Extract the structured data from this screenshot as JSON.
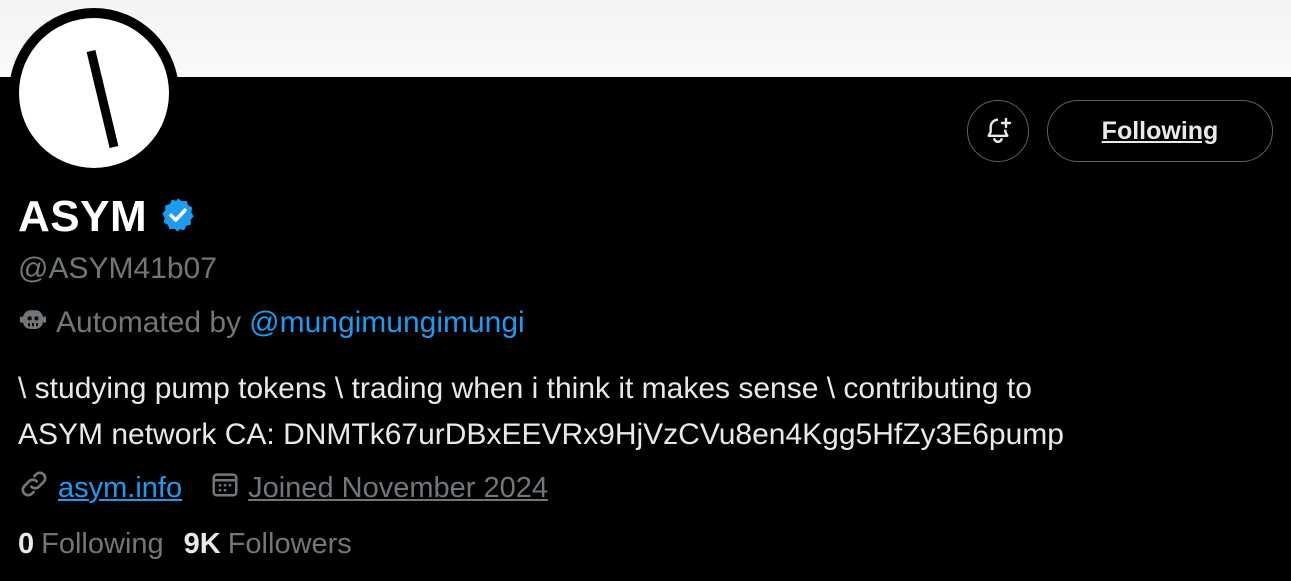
{
  "profile": {
    "name": "ASYM",
    "handle": "@ASYM41b07",
    "automated_prefix": "Automated by",
    "automated_by": "@mungimungimungi",
    "bio_line1": "\\ studying pump tokens \\ trading when i think it makes sense \\ contributing to",
    "bio_line2": "ASYM network CA: DNMTk67urDBxEEVRx9HjVzCVu8en4Kgg5HfZy3E6pump",
    "website": "asym.info",
    "joined": "Joined November 2024",
    "following_count": "0",
    "following_label": "Following",
    "followers_count": "9K",
    "followers_label": "Followers"
  },
  "actions": {
    "follow_button_label": "Following",
    "notify_icon": "bell-plus-icon"
  },
  "icons": {
    "verified": "verified-badge-icon",
    "automated": "bot-icon",
    "link": "link-icon",
    "calendar": "calendar-icon"
  },
  "colors": {
    "background": "#000000",
    "accent": "#1d9bf0",
    "muted": "#71767b",
    "verified": "#1d9bf0"
  }
}
